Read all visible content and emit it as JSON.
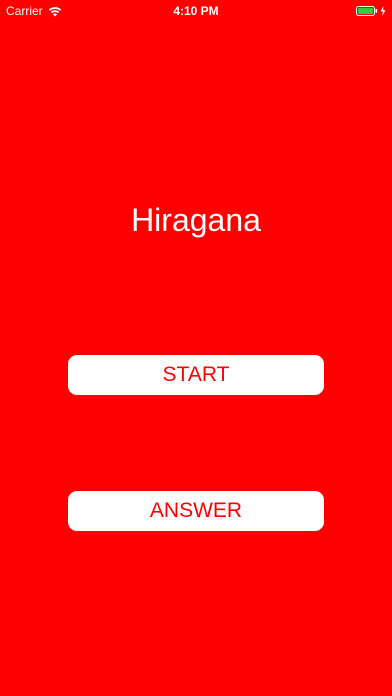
{
  "status_bar": {
    "carrier": "Carrier",
    "time": "4:10 PM",
    "wifi_icon": "wifi-icon",
    "battery_icon": "battery-icon",
    "charging_icon": "bolt-icon",
    "battery_color": "#2ecc40"
  },
  "main": {
    "title": "Hiragana",
    "start_label": "START",
    "answer_label": "ANSWER"
  },
  "colors": {
    "background": "#ff0000",
    "button_background": "#ffffff",
    "button_text": "#ff0000",
    "title_text": "#ffffff"
  }
}
